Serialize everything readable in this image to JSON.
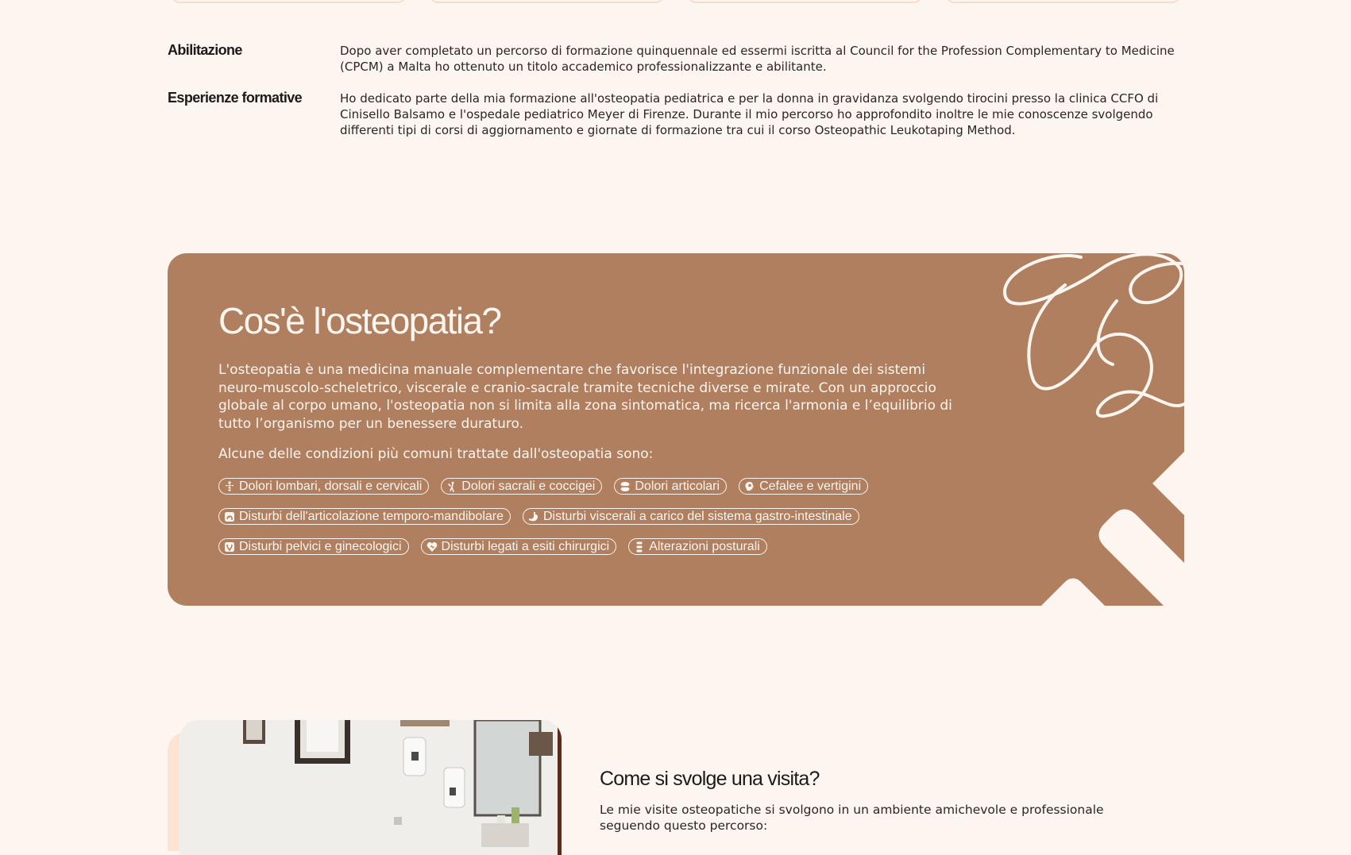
{
  "credentials": [
    {
      "label": "Abilitazione",
      "text": "Dopo aver completato un percorso di formazione quinquennale ed essermi iscritta al Council for the Profession Complementary to Medicine (CPCM) a Malta ho ottenuto un titolo accademico professionalizzante e abilitante."
    },
    {
      "label": "Esperienze formative",
      "text": "Ho dedicato parte della mia formazione all'osteopatia pediatrica e per la donna in gravidanza svolgendo tirocini presso la clinica CCFO di Cinisello Balsamo e l'ospedale pediatrico Meyer di Firenze. Durante il mio percorso ho approfondito inoltre le mie conoscenze svolgendo differenti tipi di corsi di aggiornamento e giornate di formazione tra cui il corso Osteopathic Leukotaping Method."
    }
  ],
  "osteopathy": {
    "title": "Cos'è l'osteopatia?",
    "description": "L'osteopatia è una medicina manuale complementare che favorisce l'integrazione funzionale dei sistemi neuro-muscolo-scheletrico, viscerale e cranio-sacrale tramite tecniche diverse e mirate. Con un approccio globale al corpo umano, l'osteopatia non si limita alla zona sintomatica, ma ricerca l'armonia e l’equilibrio di tutto l’organismo per un benessere duraturo.",
    "conditions_intro": "Alcune delle condizioni più comuni trattate dall'osteopatia sono:",
    "conditions": [
      {
        "label": "Dolori lombari, dorsali e cervicali",
        "icon": "spine-icon"
      },
      {
        "label": "Dolori sacrali e coccigei",
        "icon": "back-pain-icon"
      },
      {
        "label": "Dolori articolari",
        "icon": "joint-icon"
      },
      {
        "label": "Cefalee e vertigini",
        "icon": "head-icon"
      },
      {
        "label": "Disturbi dell'articolazione temporo-mandibolare",
        "icon": "jaw-icon"
      },
      {
        "label": "Disturbi viscerali a carico del sistema gastro-intestinale",
        "icon": "stomach-icon"
      },
      {
        "label": "Disturbi pelvici e ginecologici",
        "icon": "pelvis-icon"
      },
      {
        "label": "Disturbi legati a esiti chirurgici",
        "icon": "heart-icon"
      },
      {
        "label": "Alterazioni posturali",
        "icon": "posture-icon"
      }
    ]
  },
  "visit": {
    "title": "Come si svolge una visita?",
    "text": "Le mie visite osteopatiche si svolgono in un ambiente amichevole e professionale seguendo questo percorso:"
  },
  "colors": {
    "background": "#fdf5ef",
    "card": "#b07f5f",
    "accent_light": "#fde3d2"
  }
}
